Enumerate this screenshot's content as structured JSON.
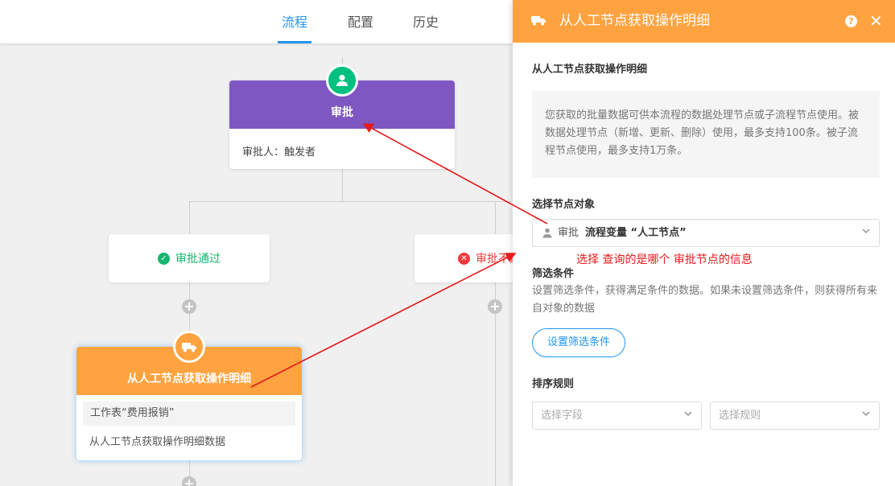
{
  "tabs": [
    {
      "label": "流程",
      "active": true
    },
    {
      "label": "配置",
      "active": false
    },
    {
      "label": "历史",
      "active": false
    }
  ],
  "approval_node": {
    "title": "审批",
    "approver_label": "审批人：",
    "approver_value": "触发者",
    "color": "#7e57c2",
    "badge_color": "#00c07f"
  },
  "branches": [
    {
      "label": "审批通过",
      "status": "pass",
      "color": "#15b56d"
    },
    {
      "label": "审批不通过",
      "status": "reject",
      "color": "#f03a3a"
    }
  ],
  "fetch_node": {
    "title": "从人工节点获取操作明细",
    "worksheet": "工作表“费用报销”",
    "summary": "从人工节点获取操作明细数据",
    "color": "#ffa340"
  },
  "panel": {
    "title": "从人工节点获取操作明细",
    "heading": "从人工节点获取操作明细",
    "info": "您获取的批量数据可供本流程的数据处理节点或子流程节点使用。被数据处理节点（新增、更新、删除）使用，最多支持100条。被子流程节点使用，最多支持1万条。",
    "select_node_label": "选择节点对象",
    "selected_node_prefix": "审批",
    "selected_node_value": "流程变量 “人工节点”",
    "filter_label": "筛选条件",
    "filter_desc": "设置筛选条件，获得满足条件的数据。如果未设置筛选条件，则获得所有来自对象的数据",
    "filter_button": "设置筛选条件",
    "sort_label": "排序规则",
    "sort_field_placeholder": "选择字段",
    "sort_rule_placeholder": "选择规则",
    "accent": "#ffa340"
  },
  "annotation": "选择 查询的是哪个 审批节点的信息"
}
